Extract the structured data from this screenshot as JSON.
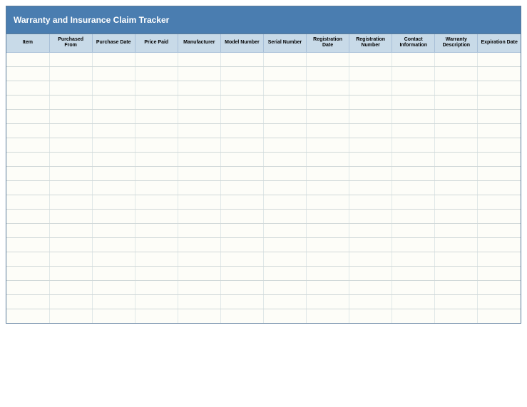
{
  "title": "Warranty and Insurance Claim Tracker",
  "columns": [
    "Item",
    "Purchased From",
    "Purchase Date",
    "Price Paid",
    "Manufacturer",
    "Model Number",
    "Serial Number",
    "Registration Date",
    "Registration Number",
    "Contact Information",
    "Warranty Description",
    "Expiration Date"
  ],
  "rows": [
    [
      "",
      "",
      "",
      "",
      "",
      "",
      "",
      "",
      "",
      "",
      "",
      ""
    ],
    [
      "",
      "",
      "",
      "",
      "",
      "",
      "",
      "",
      "",
      "",
      "",
      ""
    ],
    [
      "",
      "",
      "",
      "",
      "",
      "",
      "",
      "",
      "",
      "",
      "",
      ""
    ],
    [
      "",
      "",
      "",
      "",
      "",
      "",
      "",
      "",
      "",
      "",
      "",
      ""
    ],
    [
      "",
      "",
      "",
      "",
      "",
      "",
      "",
      "",
      "",
      "",
      "",
      ""
    ],
    [
      "",
      "",
      "",
      "",
      "",
      "",
      "",
      "",
      "",
      "",
      "",
      ""
    ],
    [
      "",
      "",
      "",
      "",
      "",
      "",
      "",
      "",
      "",
      "",
      "",
      ""
    ],
    [
      "",
      "",
      "",
      "",
      "",
      "",
      "",
      "",
      "",
      "",
      "",
      ""
    ],
    [
      "",
      "",
      "",
      "",
      "",
      "",
      "",
      "",
      "",
      "",
      "",
      ""
    ],
    [
      "",
      "",
      "",
      "",
      "",
      "",
      "",
      "",
      "",
      "",
      "",
      ""
    ],
    [
      "",
      "",
      "",
      "",
      "",
      "",
      "",
      "",
      "",
      "",
      "",
      ""
    ],
    [
      "",
      "",
      "",
      "",
      "",
      "",
      "",
      "",
      "",
      "",
      "",
      ""
    ],
    [
      "",
      "",
      "",
      "",
      "",
      "",
      "",
      "",
      "",
      "",
      "",
      ""
    ],
    [
      "",
      "",
      "",
      "",
      "",
      "",
      "",
      "",
      "",
      "",
      "",
      ""
    ],
    [
      "",
      "",
      "",
      "",
      "",
      "",
      "",
      "",
      "",
      "",
      "",
      ""
    ],
    [
      "",
      "",
      "",
      "",
      "",
      "",
      "",
      "",
      "",
      "",
      "",
      ""
    ],
    [
      "",
      "",
      "",
      "",
      "",
      "",
      "",
      "",
      "",
      "",
      "",
      ""
    ],
    [
      "",
      "",
      "",
      "",
      "",
      "",
      "",
      "",
      "",
      "",
      "",
      ""
    ],
    [
      "",
      "",
      "",
      "",
      "",
      "",
      "",
      "",
      "",
      "",
      "",
      ""
    ]
  ]
}
